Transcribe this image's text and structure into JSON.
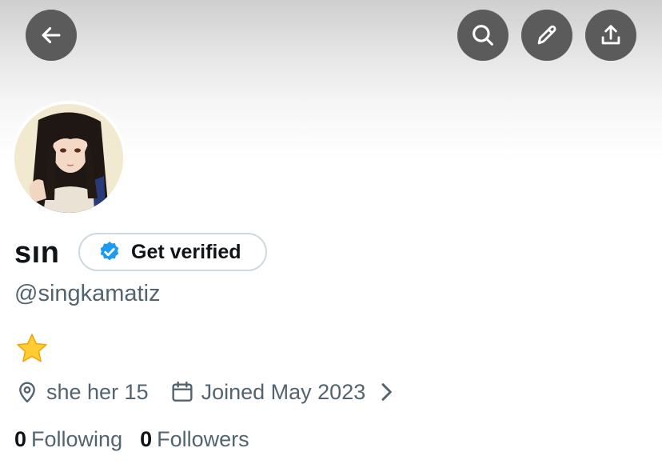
{
  "header": {
    "back_icon": "arrow-left-icon",
    "actions": [
      "search-icon",
      "pencil-icon",
      "share-icon"
    ]
  },
  "profile": {
    "name": "sın",
    "verify_button": "Get verified",
    "handle": "@singkamatiz",
    "bio_emoji": "star-emoji",
    "location": "she her 15",
    "joined": "Joined May 2023",
    "following_count": "0",
    "following_label": "Following",
    "followers_count": "0",
    "followers_label": "Followers"
  },
  "colors": {
    "button_bg": "#5b5b5b",
    "verified_blue": "#1d9bf0",
    "muted_text": "#536471",
    "primary_text": "#0f1419"
  }
}
